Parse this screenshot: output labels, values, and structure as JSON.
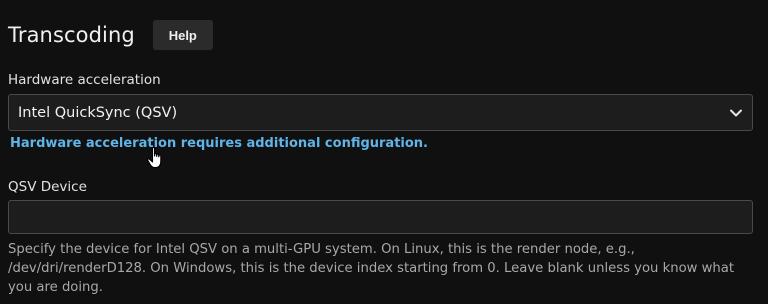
{
  "section": {
    "title": "Transcoding",
    "help_label": "Help"
  },
  "hardware_acceleration": {
    "label": "Hardware acceleration",
    "selected": "Intel QuickSync (QSV)",
    "config_link": "Hardware acceleration requires additional configuration."
  },
  "qsv_device": {
    "label": "QSV Device",
    "value": "",
    "help_text": "Specify the device for Intel QSV on a multi-GPU system. On Linux, this is the render node, e.g., /dev/dri/renderD128. On Windows, this is the device index starting from 0. Leave blank unless you know what you are doing."
  },
  "icons": {
    "dropdown": "chevron-down-icon",
    "pointer": "hand-pointer-cursor-icon"
  },
  "colors": {
    "background": "#101010",
    "link": "#5fb4e8",
    "input_background": "#1d1d1d",
    "button_background": "#2b2b2b"
  }
}
